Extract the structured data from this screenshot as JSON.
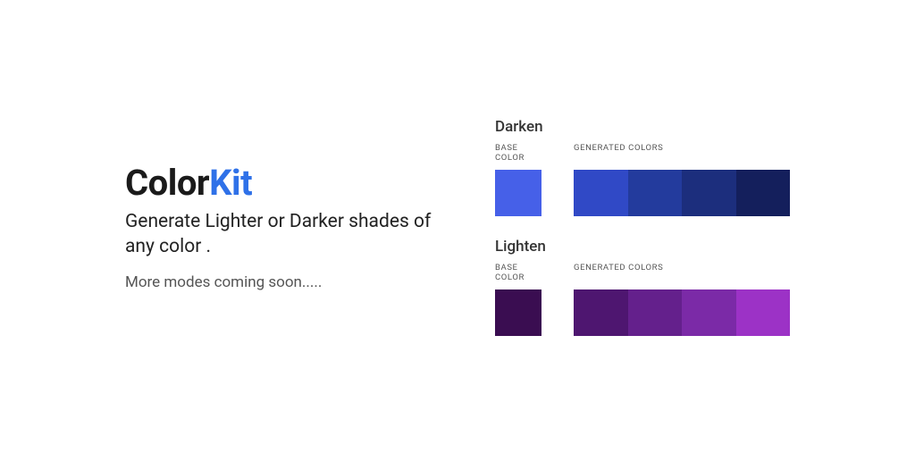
{
  "logo": {
    "part1": "Color",
    "part2": "Kit"
  },
  "tagline": "Generate Lighter or Darker shades of any color .",
  "subline": "More modes coming soon.....",
  "sections": {
    "darken": {
      "title": "Darken",
      "baseLabel": "BASE COLOR",
      "genLabel": "GENERATED COLORS",
      "base": "#4660E8",
      "generated": [
        "#3049C6",
        "#233B9D",
        "#1C2E7D",
        "#141F5C"
      ]
    },
    "lighten": {
      "title": "Lighten",
      "baseLabel": "BASE COLOR",
      "genLabel": "GENERATED COLORS",
      "base": "#3A0D51",
      "generated": [
        "#4E1670",
        "#64208C",
        "#7B2AA7",
        "#9C32C6"
      ]
    }
  }
}
